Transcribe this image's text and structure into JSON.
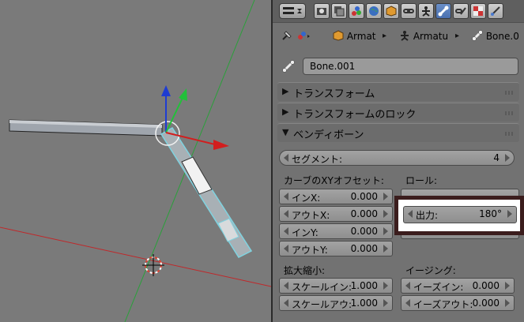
{
  "viewport": {
    "bone_color": "#8aa0ac",
    "selected_color": "#7fd3e0",
    "axis_x_color": "#d21e1e",
    "axis_y_color": "#22c03a",
    "axis_z_color": "#1e3cd2"
  },
  "header": {
    "editor_type_icon": "editor-type-icon",
    "tabs": [
      "render-icon",
      "render-layers-icon",
      "scene-icon",
      "world-icon",
      "object-icon",
      "constraints-icon",
      "modifiers-icon",
      "bone-icon",
      "bone-constraints-icon",
      "texture-icon",
      "brush-icon"
    ],
    "active_tab": "bone-icon"
  },
  "breadcrumb": {
    "items": [
      {
        "icon": "object-icon",
        "label": "Armat"
      },
      {
        "icon": "armature-icon",
        "label": "Armatu"
      },
      {
        "icon": "bone-icon",
        "label": "Bone.0"
      }
    ]
  },
  "bone_name": "Bone.001",
  "sections": {
    "transform": "トランスフォーム",
    "transform_lock": "トランスフォームのロック",
    "bendy_bones": "ベンディボーン"
  },
  "bendy": {
    "segments_label": "セグメント:",
    "segments_value": "4",
    "curve_offset_label": "カーブのXYオフセット:",
    "roll_label": "ロール:",
    "in_x_label": "インX:",
    "in_x_value": "0.000",
    "out_x_label": "アウトX:",
    "out_x_value": "0.000",
    "in_y_label": "インY:",
    "in_y_value": "0.000",
    "out_y_label": "アウトY:",
    "out_y_value": "0.000",
    "roll_out_label": "出力:",
    "roll_out_value": "180°",
    "scale_label": "拡大縮小:",
    "scale_in_label": "スケールイン:",
    "scale_in_value": "1.000",
    "scale_out_label": "スケールアウ:",
    "scale_out_value": "1.000",
    "easing_label": "イージング:",
    "ease_in_label": "イーズイン:",
    "ease_in_value": "0.000",
    "ease_out_label": "イーズアウト:",
    "ease_out_value": "0.000"
  }
}
